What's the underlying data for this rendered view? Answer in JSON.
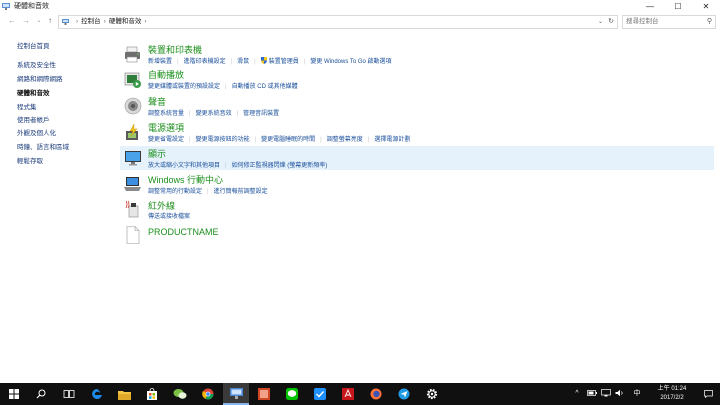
{
  "window": {
    "title": "硬體和音效",
    "minimize_glyph": "—",
    "maximize_glyph": "☐",
    "close_glyph": "✕"
  },
  "addressbar": {
    "back_glyph": "←",
    "forward_glyph": "→",
    "history_glyph": "⌄",
    "up_glyph": "↑",
    "separator": "›",
    "crumbs": [
      "控制台",
      "硬體和音效"
    ],
    "dropdown_glyph": "⌄",
    "refresh_glyph": "↻",
    "search_placeholder": "搜尋控制台",
    "search_glyph": "⚲"
  },
  "leftnav": {
    "items": [
      {
        "label": "控制台首頁"
      },
      {
        "label": "系統及安全性"
      },
      {
        "label": "網路和網際網路"
      },
      {
        "label": "硬體和音效"
      },
      {
        "label": "程式集"
      },
      {
        "label": "使用者帳戶"
      },
      {
        "label": "外觀及個人化"
      },
      {
        "label": "時鐘、語言和區域"
      },
      {
        "label": "輕鬆存取"
      }
    ],
    "current": "硬體和音效"
  },
  "categories": [
    {
      "title": "裝置和印表機",
      "icon": "printer-icon",
      "links": [
        "新增裝置",
        "進階印表機設定",
        "滑鼠",
        "裝置管理員",
        "變更 Windows To Go 啟動選項"
      ]
    },
    {
      "title": "自動播放",
      "icon": "autoplay-icon",
      "links": [
        "變更媒體或裝置的預設設定",
        "自動播放 CD 或其他媒體"
      ]
    },
    {
      "title": "聲音",
      "icon": "speaker-icon",
      "links": [
        "調整系統音量",
        "變更系統音效",
        "管理音訊裝置"
      ]
    },
    {
      "title": "電源選項",
      "icon": "power-options-icon",
      "links": [
        "變更省電設定",
        "變更電源按鈕的功能",
        "變更電腦睡眠的時間",
        "調整螢幕亮度",
        "選擇電源計劃"
      ]
    },
    {
      "title": "顯示",
      "icon": "display-icon",
      "links": [
        "放大或縮小文字和其他項目",
        "如何修正監視器閃爍 (螢幕更新頻率)"
      ]
    },
    {
      "title": "Windows 行動中心",
      "icon": "mobility-center-icon",
      "links": [
        "調整常用的行動設定",
        "進行簡報前調整設定"
      ]
    },
    {
      "title": "紅外線",
      "icon": "infrared-icon",
      "links": [
        "傳送或接收檔案"
      ]
    },
    {
      "title": "PRODUCTNAME",
      "icon": "blank-document-icon",
      "links": []
    }
  ],
  "taskbar": {
    "apps": [
      "windows-start-icon",
      "search-icon",
      "task-view-icon",
      "edge-icon",
      "file-explorer-icon",
      "store-icon",
      "wechat-icon",
      "chrome-icon",
      "control-panel-icon",
      "powerpoint-icon",
      "line-icon",
      "qq-icon",
      "acrobat-icon",
      "firefox-icon",
      "paper-plane-icon",
      "settings-icon"
    ],
    "tray": {
      "chevron": "^",
      "ime": "中",
      "time_period": "上午 01:24",
      "date": "2017/2/2"
    }
  }
}
